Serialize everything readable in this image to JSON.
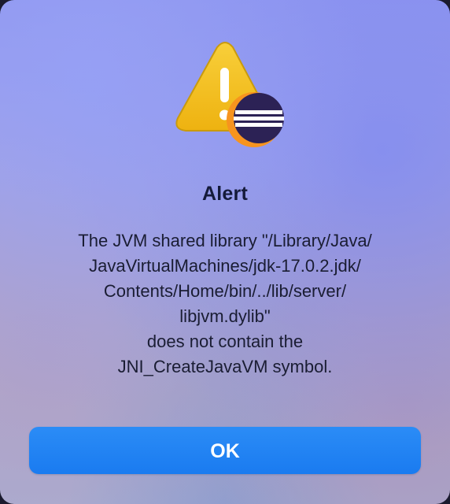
{
  "dialog": {
    "title": "Alert",
    "message_lines": [
      "The JVM shared library \"/Library/Java/",
      "JavaVirtualMachines/jdk-17.0.2.jdk/",
      "Contents/Home/bin/../lib/server/",
      "libjvm.dylib\"",
      "does not contain the",
      "JNI_CreateJavaVM symbol."
    ],
    "ok_label": "OK",
    "icon": "warning-triangle-icon",
    "badge_icon": "eclipse-logo-icon"
  },
  "colors": {
    "button": "#1f82f3",
    "warning": "#f3bf1c",
    "eclipse_dark": "#2c2255",
    "eclipse_orange": "#f7941e"
  }
}
